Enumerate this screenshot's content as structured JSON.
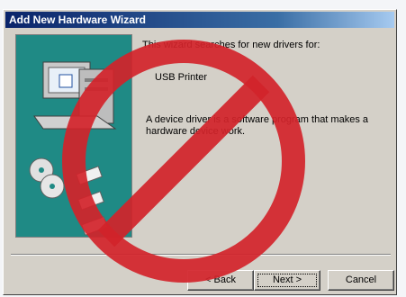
{
  "window": {
    "title": "Add New Hardware Wizard"
  },
  "wizard": {
    "intro": "This wizard searches for new drivers for:",
    "device_name": "USB Printer",
    "description": "A device driver is a software program that makes a hardware device work."
  },
  "buttons": {
    "back_label": "< Back",
    "next_label": "Next >",
    "cancel_label": "Cancel"
  },
  "overlay": {
    "icon": "no-symbol-icon",
    "color": "#d2232a"
  },
  "colors": {
    "titlebar": "#0a246a",
    "art_background": "#1f8a85",
    "dialog": "#d4d0c8"
  }
}
